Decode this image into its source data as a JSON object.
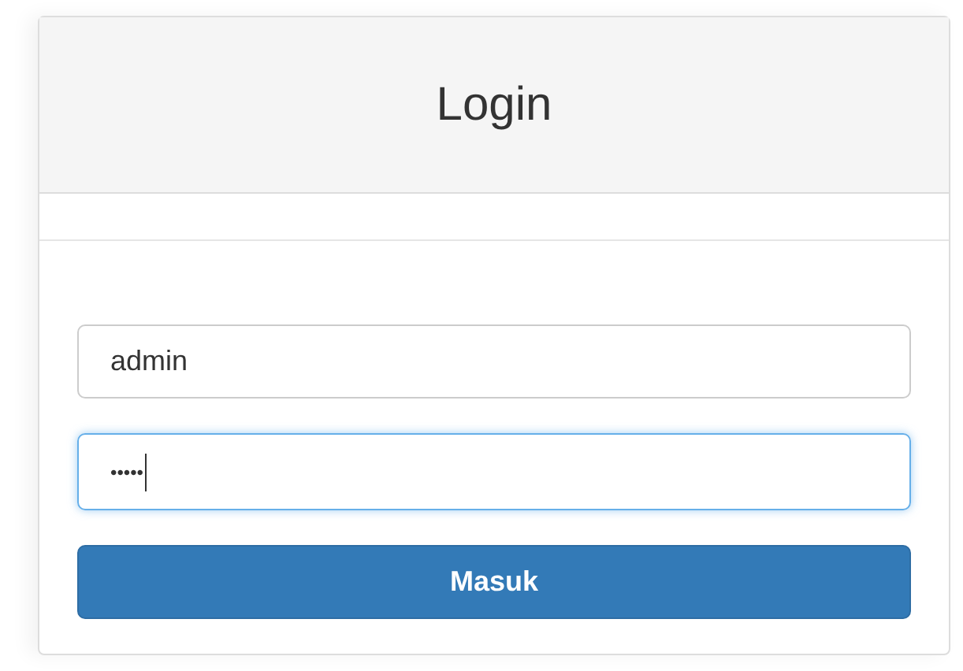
{
  "panel": {
    "title": "Login"
  },
  "fields": [
    {
      "kind": "text",
      "value": "admin",
      "focused": false
    },
    {
      "kind": "password",
      "value": "•••••",
      "focused": true
    }
  ],
  "button": {
    "label": "Masuk"
  }
}
